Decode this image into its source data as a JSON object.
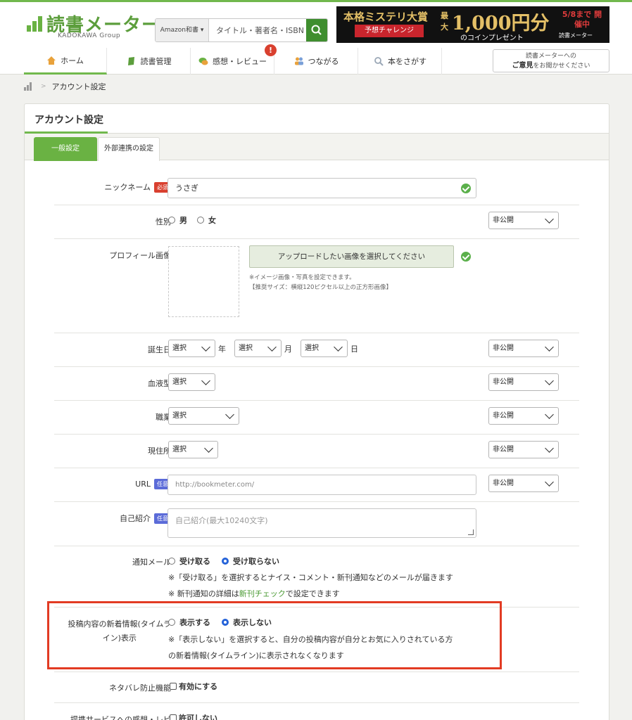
{
  "header": {
    "logo_title": "読書メーター",
    "logo_sub": "KADOKAWA Group",
    "search": {
      "category": "Amazon和書 ▾",
      "placeholder": "タイトル・著者名・ISBN"
    },
    "ad": {
      "headline": "本格ミステリ大賞",
      "ribbon": "予想チャレンジ",
      "prefix": "最大",
      "amount": "1,000円分",
      "sub": "のコインプレゼント",
      "date": "5/8まで 開催中",
      "brand": "読書メーター"
    },
    "nav": [
      {
        "label": "ホーム",
        "icon": "home-icon"
      },
      {
        "label": "読書管理",
        "icon": "book-icon"
      },
      {
        "label": "感想・レビュー",
        "icon": "chat-icon"
      },
      {
        "label": "つながる",
        "icon": "people-icon"
      },
      {
        "label": "本をさがす",
        "icon": "search-icon"
      }
    ],
    "review_badge": "!",
    "feedback_line1": "読書メーターへの",
    "feedback_bold": "ご意見",
    "feedback_rest": "をお聞かせください"
  },
  "breadcrumb": {
    "current": "アカウント設定"
  },
  "card": {
    "title": "アカウント設定",
    "tabs": [
      "一般設定",
      "外部連携の設定"
    ]
  },
  "form": {
    "required_tag": "必須",
    "optional_tag": "任意",
    "nickname": {
      "label": "ニックネーム",
      "value": "うさぎ"
    },
    "gender": {
      "label": "性別",
      "male": "男",
      "female": "女",
      "privacy": "非公開"
    },
    "profile_image": {
      "label": "プロフィール画像",
      "button": "アップロードしたい画像を選択してください",
      "note1": "※イメージ画像・写真を設定できます。",
      "note2": "【推奨サイズ：横縦120ピクセル以上の正方形画像】"
    },
    "birthday": {
      "label": "誕生日",
      "year": "選択",
      "year_unit": "年",
      "month": "選択",
      "month_unit": "月",
      "day": "選択",
      "day_unit": "日",
      "privacy": "非公開"
    },
    "blood": {
      "label": "血液型",
      "value": "選択",
      "privacy": "非公開"
    },
    "job": {
      "label": "職業",
      "value": "選択",
      "privacy": "非公開"
    },
    "residence": {
      "label": "現住所",
      "value": "選択",
      "privacy": "非公開"
    },
    "url": {
      "label": "URL",
      "placeholder": "http://bookmeter.com/",
      "privacy": "非公開"
    },
    "bio": {
      "label": "自己紹介",
      "placeholder": "自己紹介(最大10240文字)"
    },
    "mail": {
      "label": "通知メール",
      "receive": "受け取る",
      "no_receive": "受け取らない",
      "note1": "※「受け取る」を選択するとナイス・コメント・新刊通知などのメールが届きます",
      "note2_pre": "※ 新刊通知の詳細は",
      "note2_link": "新刊チェック",
      "note2_post": "で設定できます"
    },
    "timeline": {
      "label_line1": "投稿内容の新着情報(タイムラ",
      "label_line2": "イン)表示",
      "show": "表示する",
      "hide": "表示しない",
      "note1": "※「表示しない」を選択すると、自分の投稿内容が自分とお気に入りされている方",
      "note2": "の新着情報(タイムライン)に表示されなくなります"
    },
    "spoiler": {
      "label": "ネタバレ防止機能",
      "option": "有効にする"
    },
    "partner": {
      "label": "提携サービスへの感想・レビ",
      "option": "許可しない"
    }
  }
}
